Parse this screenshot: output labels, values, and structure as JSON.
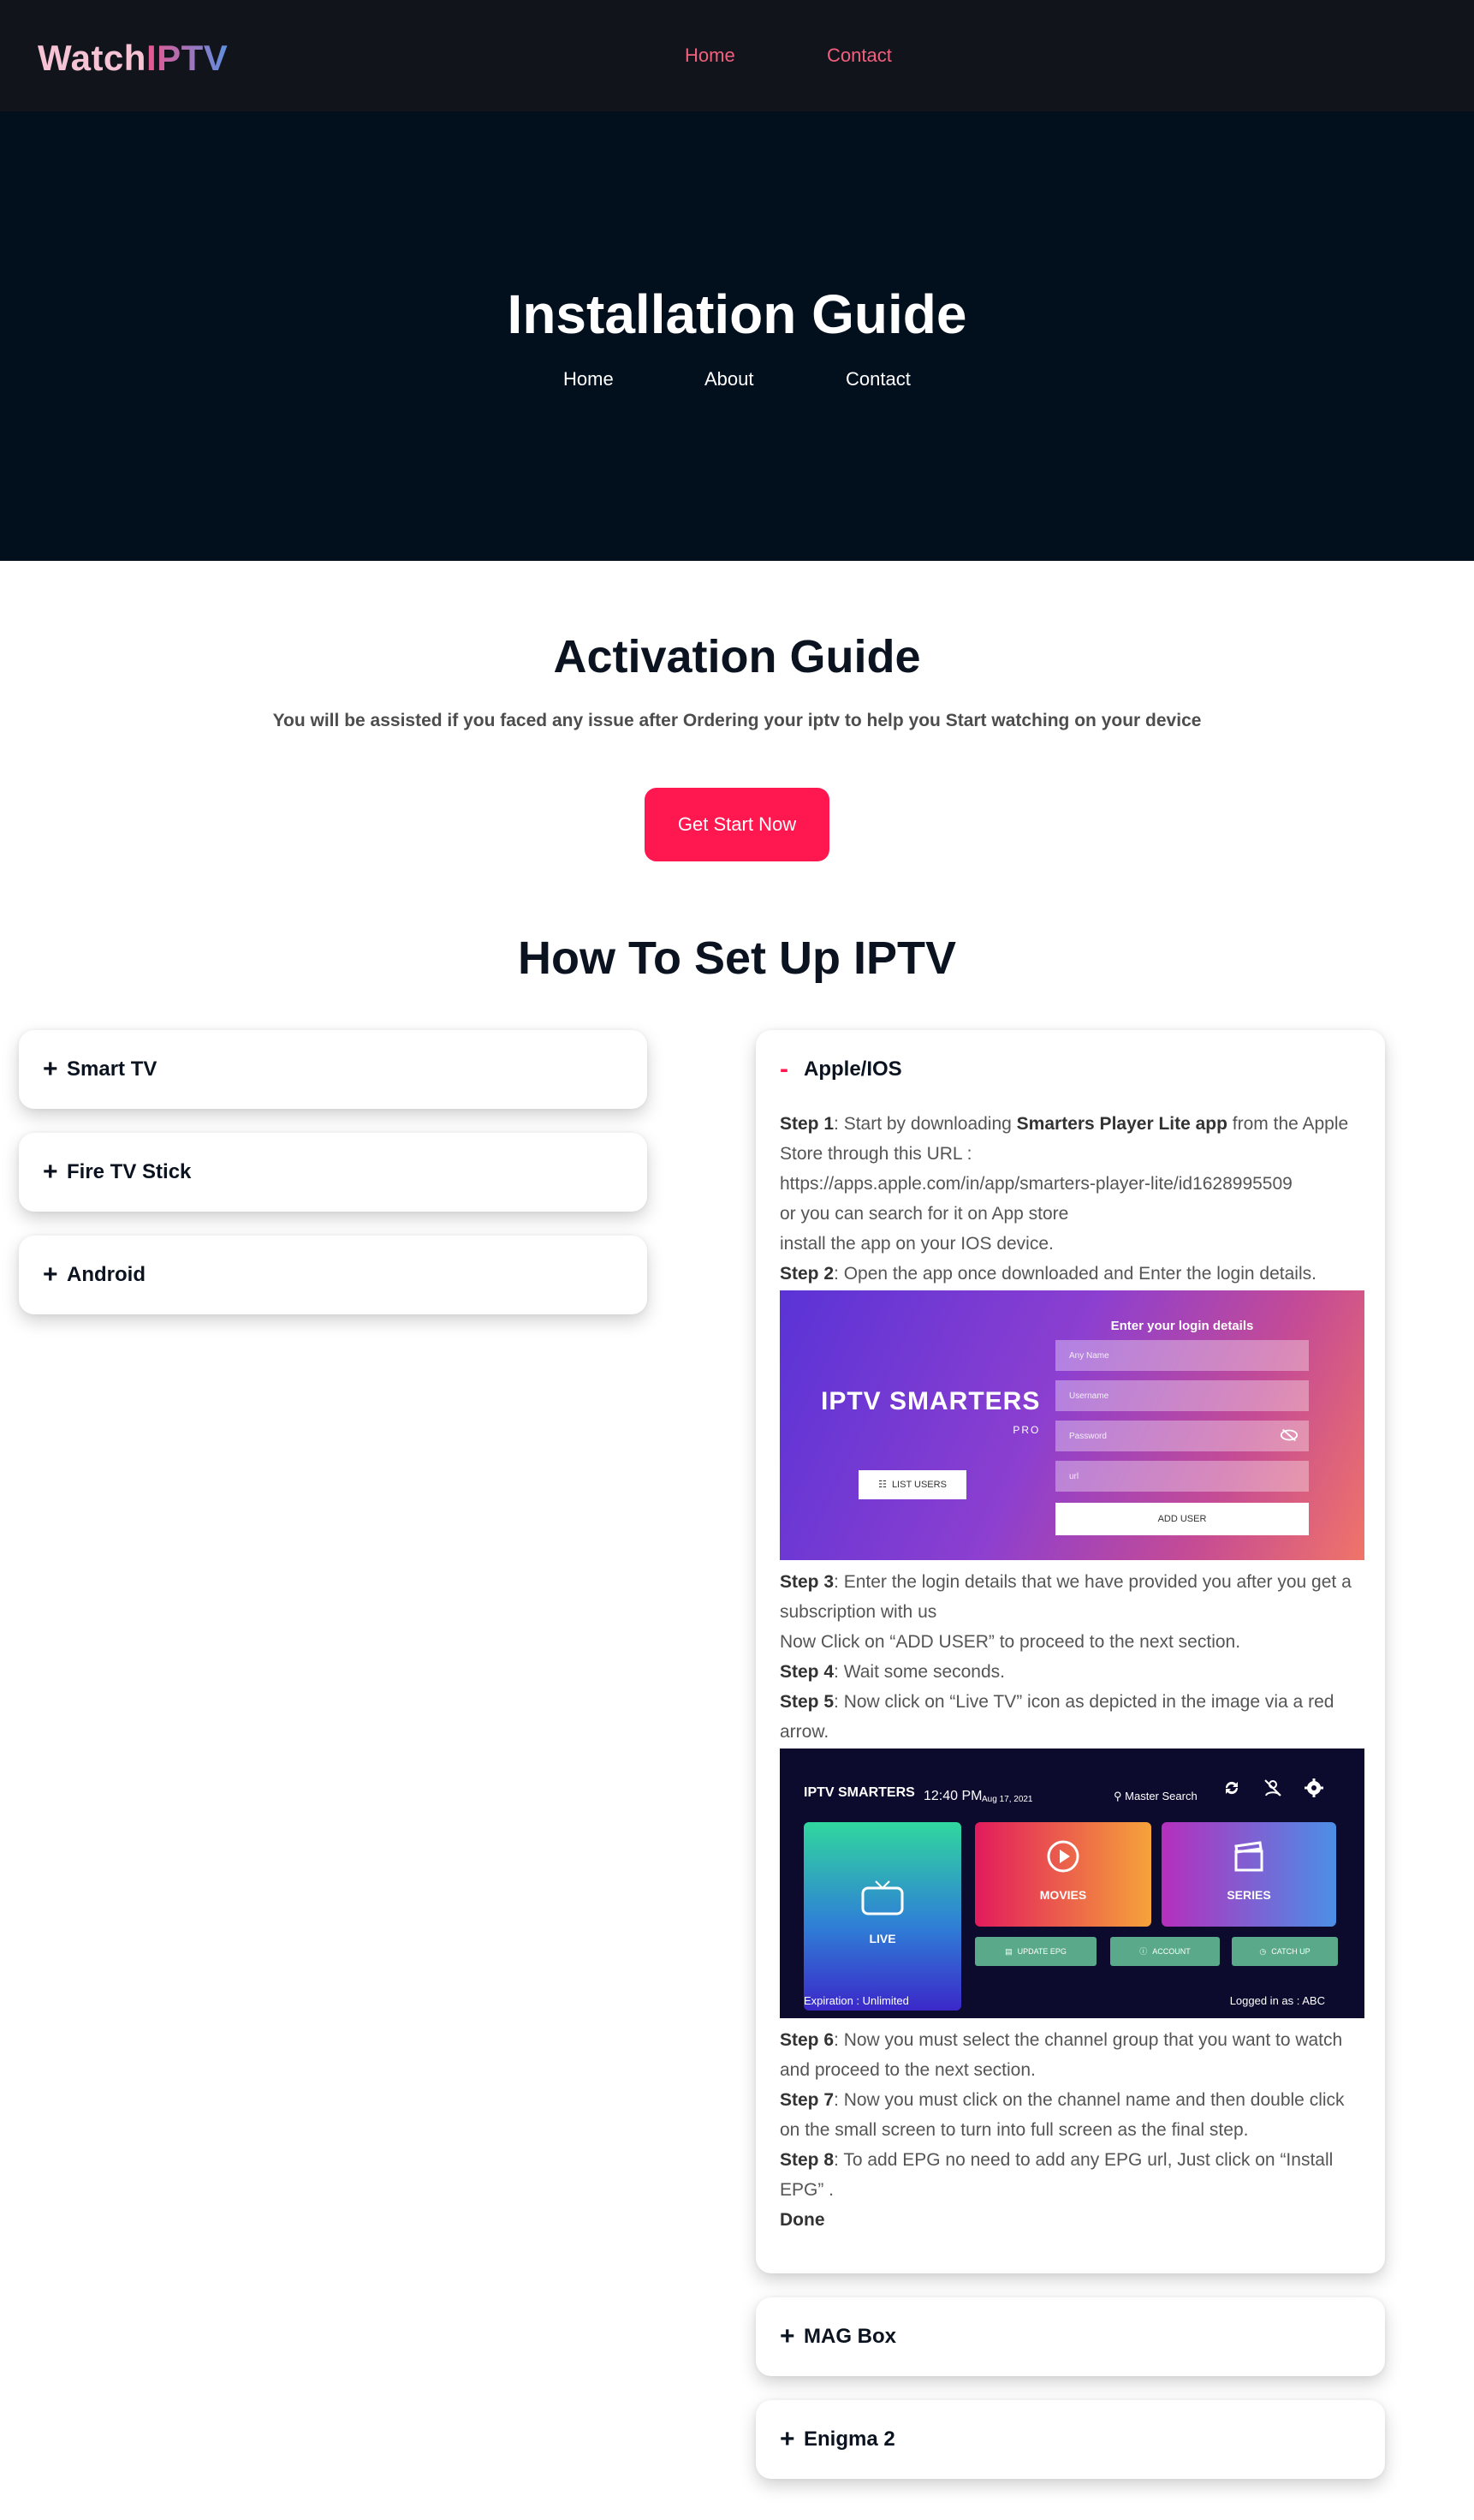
{
  "nav": {
    "logo_part1": "Watch",
    "logo_part2": "IPTV",
    "links": [
      "Home",
      "Contact"
    ]
  },
  "hero": {
    "title": "Installation Guide",
    "links": [
      "Home",
      "About",
      "Contact"
    ]
  },
  "activation": {
    "title": "Activation Guide",
    "subtitle": "You will be assisted if you faced any issue after Ordering your iptv to help you Start watching on your device",
    "cta_label": "Get Start Now"
  },
  "setup": {
    "title": "How To Set Up IPTV",
    "left_items": [
      "Smart TV",
      "Fire TV Stick",
      "Android"
    ],
    "right_items_after": [
      "MAG Box",
      "Enigma 2"
    ],
    "open_item": {
      "title": "Apple/IOS",
      "step1_label": "Step 1",
      "step1_a": ": Start by downloading ",
      "step1_bold": "Smarters Player Lite app",
      "step1_b": " from the Apple Store through this URL :",
      "url": "https://apps.apple.com/in/app/smarters-player-lite/id1628995509",
      "alt_search": "or  you can search for it on App store",
      "install": "install the app on your IOS device.",
      "step2_label": "Step 2",
      "step2": ": Open the app once downloaded and Enter the login details.",
      "step3_label": "Step 3",
      "step3": ": Enter the login details that we have provided you after you get a subscription with us",
      "click_add": "Now Click on “ADD USER” to proceed to the next section.",
      "step4_label": "Step 4",
      "step4": ": Wait some seconds.",
      "step5_label": "Step 5",
      "step5": ": Now click on “Live TV” icon as depicted in the image via a red arrow.",
      "step6_label": "Step 6",
      "step6": ": Now you must select the channel group that you want to watch and proceed to the next section.",
      "step7_label": "Step 7",
      "step7": ": Now you must click on the channel name and then double click on the small screen to turn into full screen as the final step.",
      "step8_label": "Step 8",
      "step8": ": To add EPG no need to add any EPG url, Just click on “Install EPG” .",
      "done": "Done"
    }
  },
  "login_screen": {
    "brand": "IPTV SMARTERS",
    "brand_sub": "PRO",
    "heading": "Enter your login details",
    "fields": [
      "Any Name",
      "Username",
      "Password",
      "url"
    ],
    "list_users": "LIST USERS",
    "add_user": "ADD USER"
  },
  "home_screen": {
    "brand": "IPTV SMARTERS",
    "time": "12:40 PM",
    "date": "Aug 17, 2021",
    "search": "Master Search",
    "tiles": [
      "LIVE",
      "MOVIES",
      "SERIES"
    ],
    "live_badge": "Live",
    "small_buttons": [
      "UPDATE EPG",
      "ACCOUNT",
      "CATCH UP"
    ],
    "expiration": "Expiration : Unlimited",
    "logged": "Logged in as : ABC"
  },
  "colors": {
    "nav_bg": "#12141c",
    "hero_bg": "#020f1d",
    "accent": "#ff184f",
    "nav_link": "#f2607e"
  }
}
